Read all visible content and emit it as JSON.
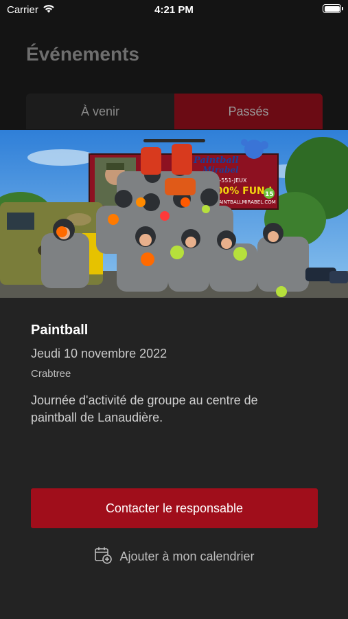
{
  "status_bar": {
    "carrier": "Carrier",
    "time": "4:21 PM",
    "icons": [
      "wifi-icon",
      "battery-icon"
    ]
  },
  "header": {
    "title": "Événements"
  },
  "tabs": [
    {
      "label": "À venir",
      "selected": false
    },
    {
      "label": "Passés",
      "selected": true
    }
  ],
  "event": {
    "image_text": {
      "brand_line1": "Paintball",
      "brand_line2": "Mirabel",
      "phone": "1-800-551-JEUX",
      "slogan": "100% FUN !",
      "website": "PAINTBALLMIRABEL.COM",
      "badge": "15"
    },
    "title": "Paintball",
    "date": "Jeudi 10 novembre 2022",
    "location": "Crabtree",
    "description": "Journée d'activité de groupe au centre de paintball de Lanaudière."
  },
  "actions": {
    "contact_label": "Contacter le responsable",
    "calendar_label": "Ajouter à mon calendrier",
    "calendar_icon": "calendar-add-icon"
  },
  "colors": {
    "background": "#141414",
    "sheet": "#232323",
    "accent": "#a00e1b",
    "active_tab": "#6b0b14"
  }
}
